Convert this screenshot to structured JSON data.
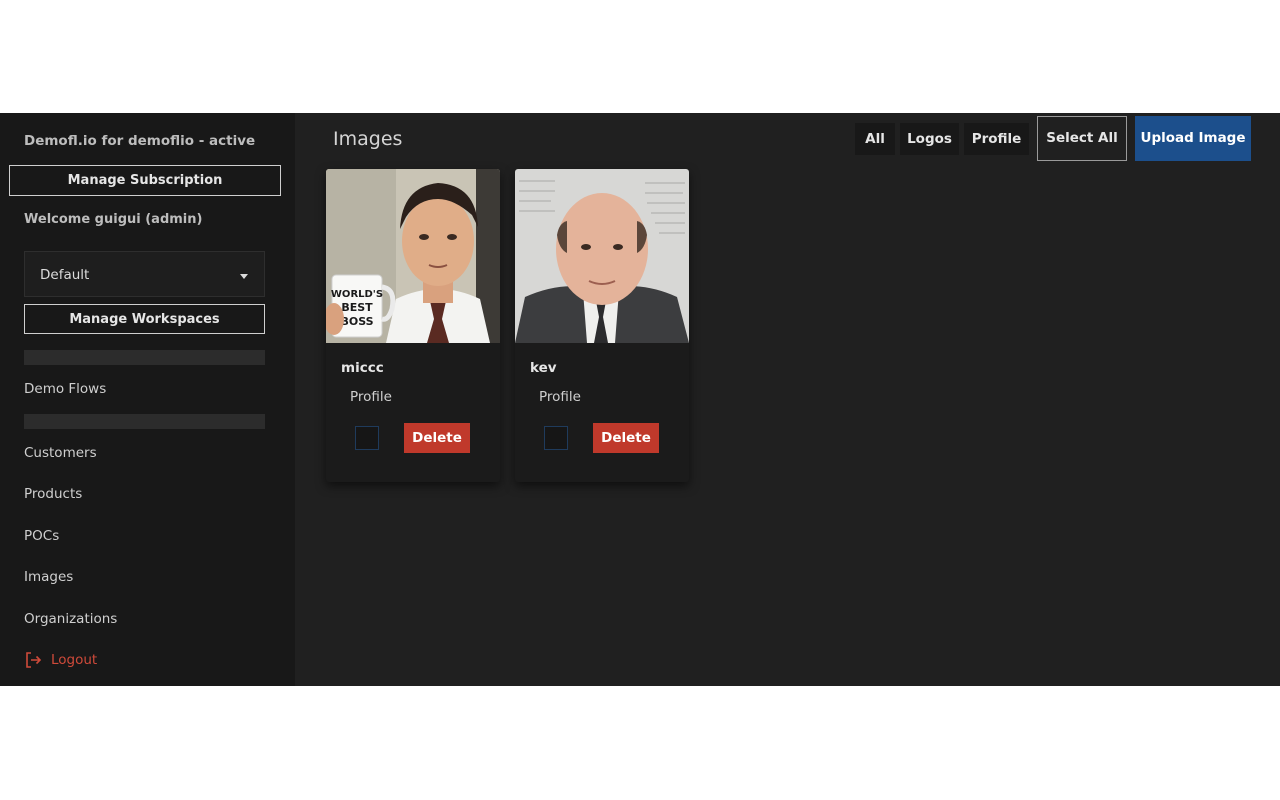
{
  "sidebar": {
    "brand": "Demofl.io for demoflio - active",
    "manage_subscription": "Manage Subscription",
    "welcome": "Welcome guigui (admin)",
    "workspace_select": {
      "value": "Default"
    },
    "manage_workspaces": "Manage Workspaces",
    "nav": {
      "demo_flows": "Demo Flows",
      "customers": "Customers",
      "products": "Products",
      "pocs": "POCs",
      "images": "Images",
      "organizations": "Organizations",
      "logout": "Logout"
    }
  },
  "main": {
    "title": "Images",
    "filters": [
      "All",
      "Logos",
      "Profile"
    ],
    "select_all": "Select All",
    "upload_image": "Upload Image",
    "cards": [
      {
        "name": "miccc",
        "tag": "Profile",
        "delete_label": "Delete",
        "mug_text": [
          "WORLD'S",
          "BEST",
          "BOSS"
        ]
      },
      {
        "name": "kev",
        "tag": "Profile",
        "delete_label": "Delete"
      }
    ]
  },
  "colors": {
    "sidebar_bg": "#181818",
    "main_bg": "#202020",
    "upload_button": "#1c4f8c",
    "delete_button": "#c0392b",
    "logout": "#cf4a3a"
  },
  "icons": {
    "logout": "logout-icon",
    "dropdown": "caret-down-icon"
  }
}
